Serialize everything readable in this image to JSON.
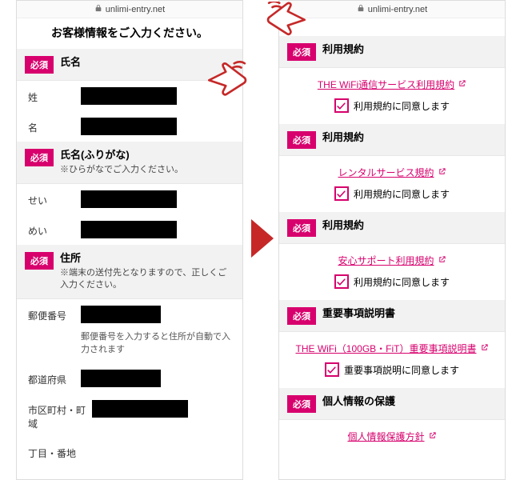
{
  "url": "unlimi-entry.net",
  "colors": {
    "accent": "#d7006d",
    "arrow": "#c62828"
  },
  "left": {
    "title": "お客様情報をご入力ください。",
    "badge": "必須",
    "sections": {
      "name": {
        "title": "氏名"
      },
      "furigana": {
        "title": "氏名(ふりがな)",
        "sub": "※ひらがなでご入力ください。"
      },
      "address": {
        "title": "住所",
        "sub": "※端末の送付先となりますので、正しくご入力ください。"
      }
    },
    "fields": {
      "sei": "姓",
      "mei": "名",
      "sei_kana": "せい",
      "mei_kana": "めい",
      "zip": "郵便番号",
      "zip_note": "郵便番号を入力すると住所が自動で入力されます",
      "pref": "都道府県",
      "city": "市区町村・町域",
      "block": "丁目・番地"
    }
  },
  "right": {
    "badge": "必須",
    "agree": "利用規約に同意します",
    "agree_important": "重要事項説明に同意します",
    "sections": [
      {
        "title": "利用規約",
        "link": "THE WiFi通信サービス利用規約",
        "type": "agree"
      },
      {
        "title": "利用規約",
        "link": "レンタルサービス規約",
        "type": "agree"
      },
      {
        "title": "利用規約",
        "link": "安心サポート利用規約",
        "type": "agree"
      },
      {
        "title": "重要事項説明書",
        "link": "THE WiFi（100GB・FiT）重要事項説明書",
        "type": "important"
      },
      {
        "title": "個人情報の保護",
        "link": "個人情報保護方針",
        "type": "none"
      }
    ]
  }
}
